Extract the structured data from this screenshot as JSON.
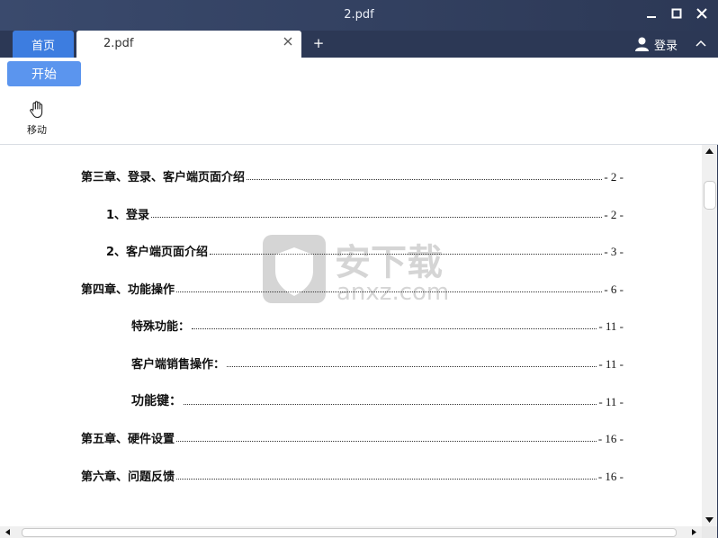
{
  "window": {
    "title": "2.pdf"
  },
  "tabs": {
    "home_label": "首页",
    "doc_label": "2.pdf",
    "add_label": "+"
  },
  "account": {
    "login_label": "登录"
  },
  "toolbar": {
    "start_label": "开始",
    "move_label": "移动"
  },
  "watermark": {
    "brand": "安下载",
    "domain": "anxz.com"
  },
  "toc": [
    {
      "title": "第三章、登录、客户端页面介绍",
      "page": "- 2 -"
    },
    {
      "title": "1、登录",
      "page": "- 2 -"
    },
    {
      "title": "2、客户端页面介绍",
      "page": "- 3 -"
    },
    {
      "title": "第四章、功能操作",
      "page": "- 6 -"
    },
    {
      "title": "特殊功能：",
      "page": "- 11 -"
    },
    {
      "title": "客户端销售操作：",
      "page": "- 11 -"
    },
    {
      "title": "功能键：",
      "page": "- 11 -"
    },
    {
      "title": "第五章、硬件设置",
      "page": "- 16 -"
    },
    {
      "title": "第六章、问题反馈",
      "page": "- 16 -"
    }
  ],
  "icons": {
    "minimize": "minimize-icon",
    "maximize": "maximize-icon",
    "close": "close-icon",
    "tab_close": "tab-close-icon",
    "user": "user-icon",
    "collapse": "chevron-up-icon",
    "hand": "hand-icon"
  },
  "colors": {
    "title_bar": "#2c3855",
    "accent": "#3d7de0",
    "start_button": "#5b95ee"
  }
}
